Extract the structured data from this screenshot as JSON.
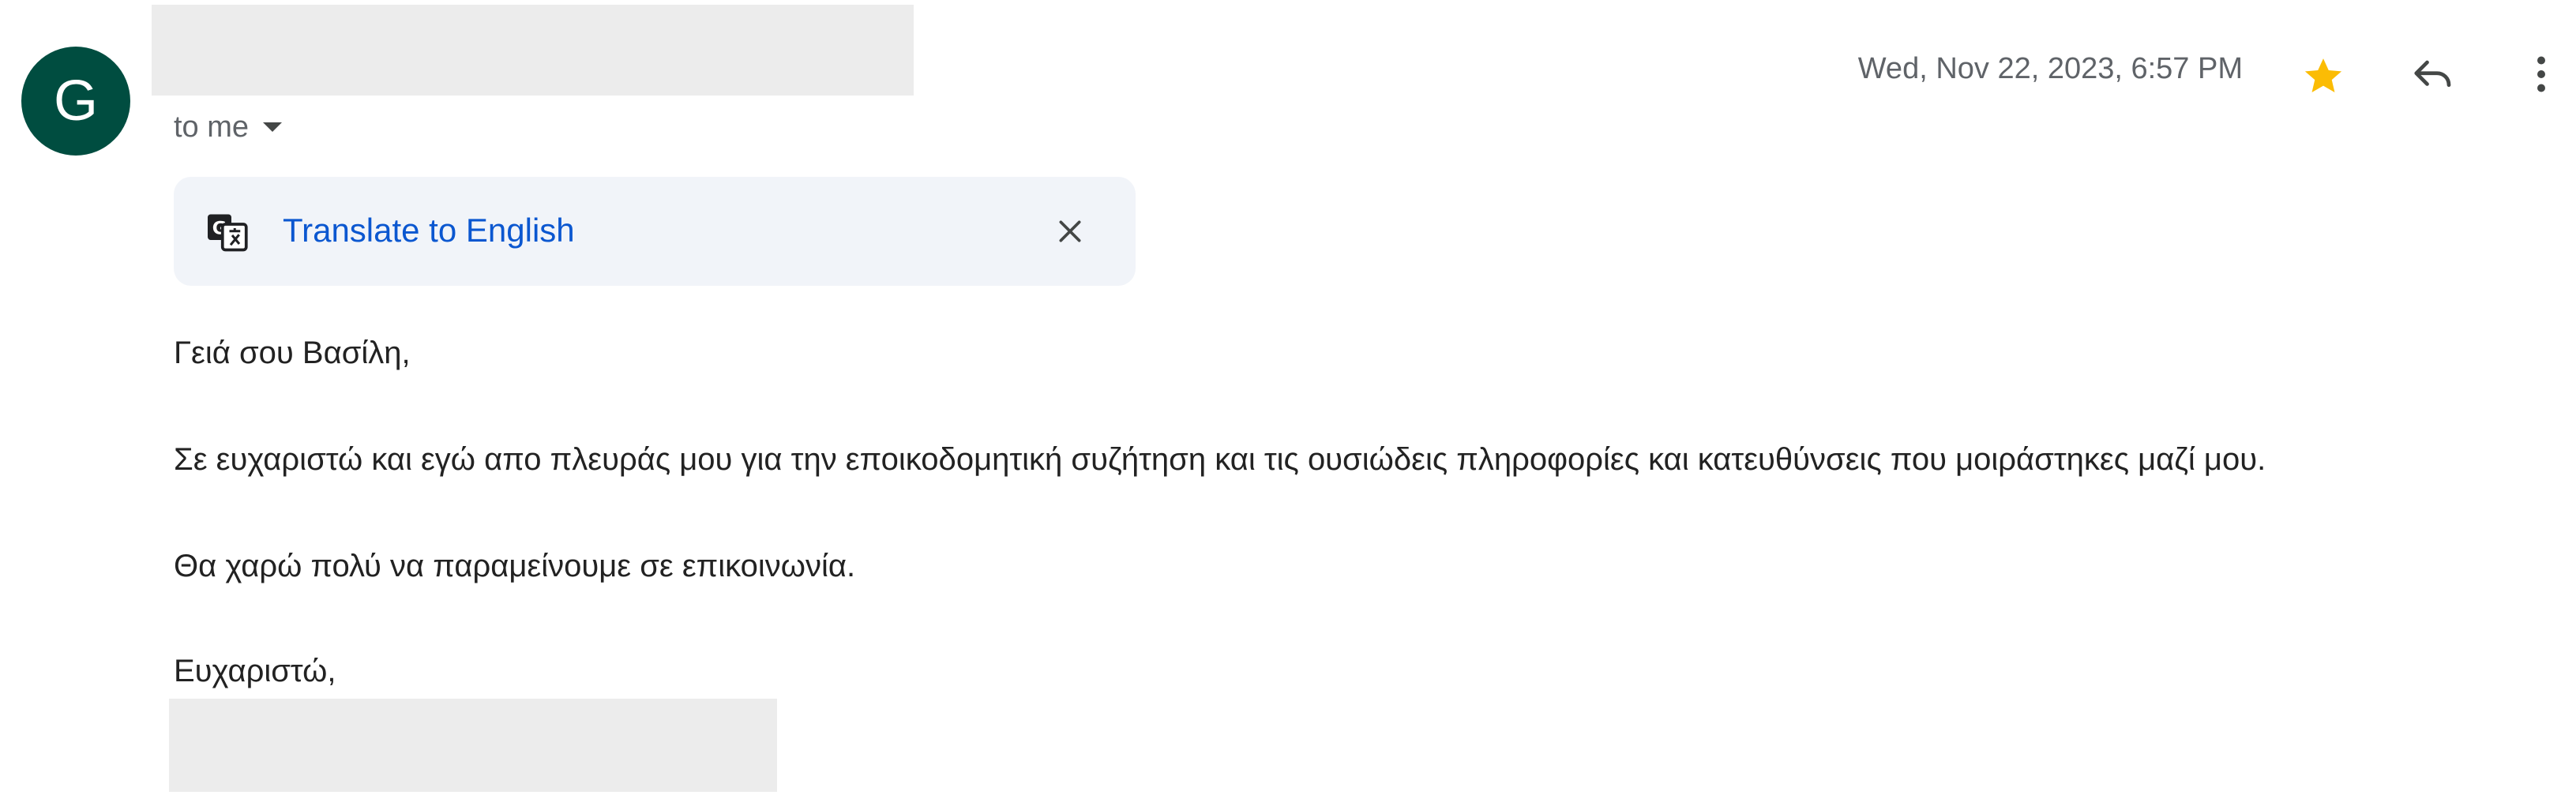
{
  "sender": {
    "avatar_letter": "G",
    "avatar_color": "#004d40",
    "name_redacted": true
  },
  "recipient": {
    "to_label": "to me"
  },
  "date": "Wed, Nov 22, 2023, 6:57 PM",
  "actions": {
    "star_color": "#fbbc04",
    "icons": [
      "star-icon",
      "reply-icon",
      "more-vert-icon"
    ]
  },
  "translate": {
    "link_label": "Translate to English",
    "icons": [
      "translate-icon",
      "close-icon"
    ]
  },
  "message": {
    "greeting": "Γειά σου Βασίλη,",
    "paragraph1": "Σε ευχαριστώ και εγώ απο πλευράς μου για την εποικοδομητική συζήτηση και τις ουσιώδεις πληροφορίες και κατευθύνσεις που μοιράστηκες μαζί μου.",
    "paragraph2": "Θα χαρώ πολύ να παραμείνουμε σε επικοινωνία.",
    "closing": "Ευχαριστώ,",
    "signature_redacted": true
  }
}
